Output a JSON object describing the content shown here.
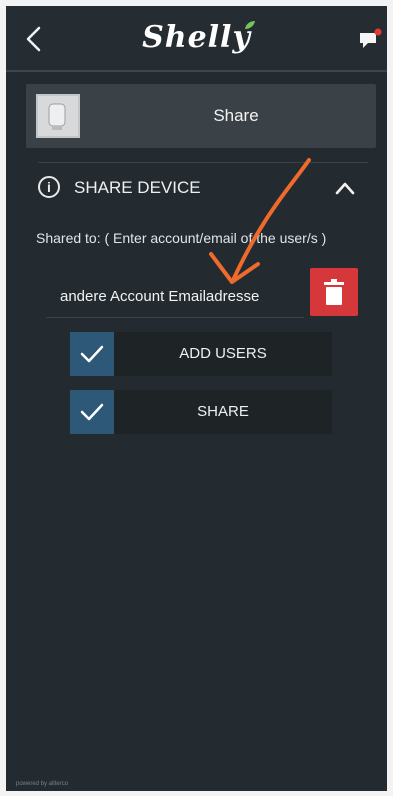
{
  "header": {
    "brand": "Shelly",
    "back_icon": "chevron-left-icon",
    "chat_icon": "chat-notification-icon",
    "notification_dot_color": "#e53935"
  },
  "device": {
    "title": "Share",
    "thumbnail_icon": "device-plug-icon"
  },
  "section": {
    "title": "SHARE DEVICE",
    "info_icon": "i",
    "collapse_icon": "chevron-up-icon"
  },
  "share": {
    "hint": "Shared to: ( Enter account/email of the user/s )",
    "email_value": "andere Account Emailadresse",
    "delete_icon": "trash-icon",
    "delete_color": "#d6373a"
  },
  "options": [
    {
      "label": "ADD USERS",
      "checked": true
    },
    {
      "label": "SHARE",
      "checked": true
    }
  ],
  "footer": {
    "tiny_text": "powered by allterco"
  },
  "colors": {
    "background": "#242b30",
    "accent": "#2d5877",
    "annotation_arrow": "#ef6a2d"
  }
}
